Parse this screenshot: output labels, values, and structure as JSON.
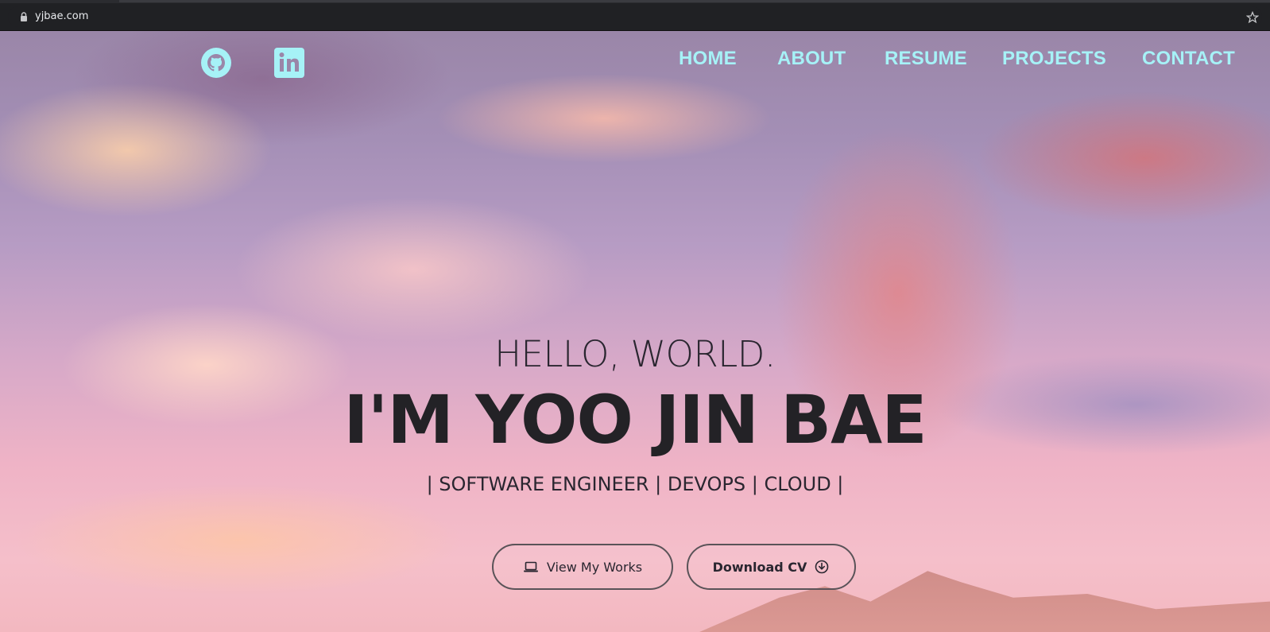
{
  "browser": {
    "url": "yjbae.com",
    "lock_icon": "lock-icon",
    "bookmark_icon": "star-icon"
  },
  "nav": {
    "social": [
      {
        "name": "github",
        "icon": "github-icon"
      },
      {
        "name": "linkedin",
        "icon": "linkedin-icon"
      }
    ],
    "links": [
      "HOME",
      "ABOUT",
      "RESUME",
      "PROJECTS",
      "CONTACT"
    ]
  },
  "hero": {
    "greeting": "HELLO, WORLD.",
    "name": "I'M YOO JIN BAE",
    "roles": "| SOFTWARE ENGINEER | DEVOPS | CLOUD |",
    "buttons": {
      "works_label": "View My Works",
      "works_icon": "laptop-icon",
      "cv_label": "Download CV",
      "cv_icon": "download-circle-icon"
    }
  },
  "colors": {
    "nav_link": "#a6f2f7",
    "heading_text": "#232226",
    "browser_bar": "#202124"
  }
}
